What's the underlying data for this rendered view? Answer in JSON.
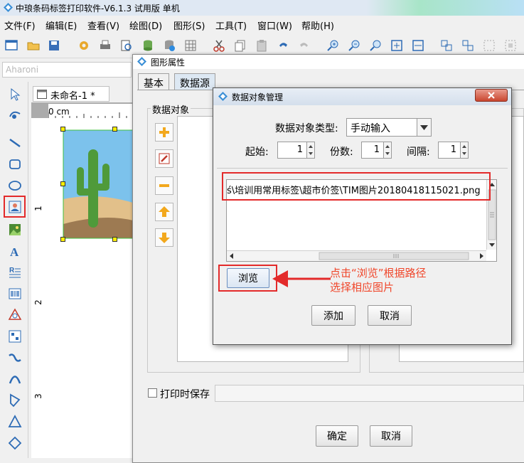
{
  "titlebar": {
    "title": "中琅条码标签打印软件-V6.1.3 试用版 单机"
  },
  "menubar": {
    "items": [
      "文件(F)",
      "编辑(E)",
      "查看(V)",
      "绘图(D)",
      "图形(S)",
      "工具(T)",
      "窗口(W)",
      "帮助(H)"
    ]
  },
  "fontbox": {
    "value": "Aharoni"
  },
  "document": {
    "tab_label": "未命名-1 *",
    "ruler_top_label": "0 cm",
    "ruler_left_labels": [
      "1",
      "2",
      "3"
    ]
  },
  "properties": {
    "title": "图形属性",
    "tabs": [
      "基本",
      "数据源"
    ],
    "group_label": "数据对象",
    "print_save_label": "打印时保存",
    "ok_label": "确定",
    "cancel_label": "取消"
  },
  "dialog": {
    "title": "数据对象管理",
    "type_label": "数据对象类型:",
    "type_value": "手动输入",
    "start_label": "起始:",
    "start_value": "1",
    "copies_label": "份数:",
    "copies_value": "1",
    "interval_label": "间隔:",
    "interval_value": "1",
    "path_value": "ś\\培训用常用标签\\超市价签\\TIM图片20180418115021.png",
    "browse_label": "浏览",
    "add_label": "添加",
    "cancel_label": "取消"
  },
  "annotation": {
    "line1": "点击“浏览”根据路径",
    "line2": "选择相应图片",
    "color": "#f0462a"
  },
  "colors": {
    "highlight": "#e32a2a",
    "active_tab": "#dde8f3"
  }
}
